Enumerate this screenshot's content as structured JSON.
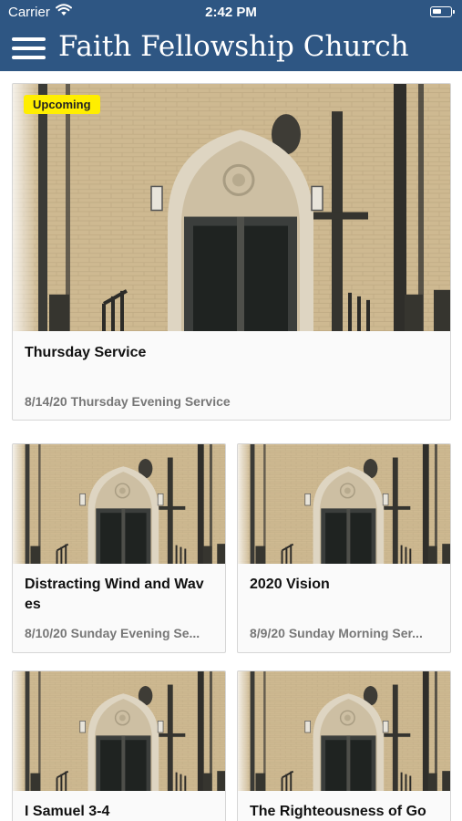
{
  "status_bar": {
    "carrier": "Carrier",
    "time": "2:42 PM"
  },
  "header": {
    "title": "Faith Fellowship Church",
    "menu_icon": "hamburger-menu-icon"
  },
  "colors": {
    "header_bg": "#2e5683",
    "badge_bg": "#ffee00"
  },
  "featured": {
    "badge": "Upcoming",
    "title": "Thursday Service",
    "subtitle": "8/14/20 Thursday Evening Service"
  },
  "items": [
    {
      "title": "Distracting Wind and Waves",
      "subtitle": "8/10/20 Sunday Evening Se..."
    },
    {
      "title": "2020 Vision",
      "subtitle": "8/9/20 Sunday Morning Ser..."
    },
    {
      "title": "I Samuel 3-4",
      "subtitle": ""
    },
    {
      "title": "The Righteousness of Go",
      "subtitle": ""
    }
  ]
}
